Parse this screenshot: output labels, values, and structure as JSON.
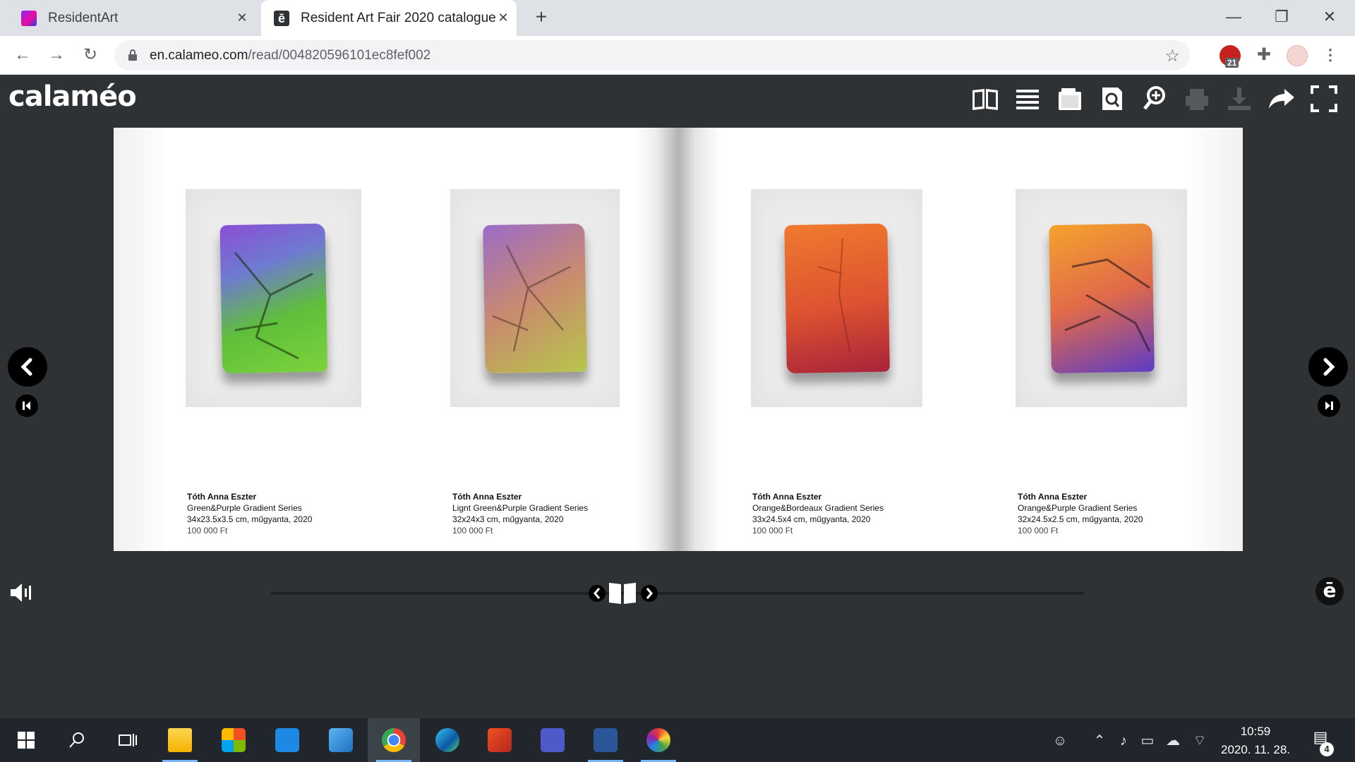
{
  "browser": {
    "tabs": [
      {
        "title": "ResidentArt",
        "close": "✕"
      },
      {
        "title": "Resident Art Fair 2020 catalogue",
        "close": "✕",
        "favicon_text": "ē"
      }
    ],
    "new_tab": "+",
    "window_controls": {
      "minimize": "—",
      "restore": "❐",
      "close": "✕"
    },
    "nav": {
      "back": "←",
      "forward": "→",
      "reload": "↻"
    },
    "url_host": "en.calameo.com",
    "url_path": "/read/004820596101ec8fef002",
    "bookmark_star": "☆",
    "extension_badge": "21",
    "extensions_icon": "✚",
    "menu": "⋮"
  },
  "viewer": {
    "logo": "calaméo",
    "toolbar_icons": [
      "book-view-icon",
      "list-icon",
      "pages-icon",
      "search-icon",
      "zoom-icon",
      "print-icon",
      "download-icon",
      "share-icon",
      "fullscreen-icon"
    ],
    "artworks": [
      {
        "artist": "Tóth Anna Eszter",
        "title": "Green&Purple Gradient Series",
        "details": "34x23.5x3.5 cm, műgyanta, 2020",
        "price": "100 000 Ft",
        "colors": [
          "#8a4fd6",
          "#5fbf3a",
          "#7dd33c"
        ]
      },
      {
        "artist": "Tóth Anna Eszter",
        "title": "Lignt Green&Purple Gradient Series",
        "details": "32x24x3 cm, műgyanta, 2020",
        "price": "100 000 Ft",
        "colors": [
          "#9c6bc9",
          "#c98b6e",
          "#b7c64b"
        ]
      },
      {
        "artist": "Tóth Anna Eszter",
        "title": "Orange&Bordeaux Gradient Series",
        "details": "33x24.5x4 cm, műgyanta, 2020",
        "price": "100 000 Ft",
        "colors": [
          "#f07a2e",
          "#dd5230",
          "#a8233a"
        ]
      },
      {
        "artist": "Tóth Anna Eszter",
        "title": "Orange&Purple Gradient Series",
        "details": "32x24.5x2.5 cm, műgyanta, 2020",
        "price": "100 000 Ft",
        "colors": [
          "#f6a22c",
          "#e06a4a",
          "#5d3bc7"
        ]
      }
    ],
    "calameo_badge": "ē"
  },
  "taskbar": {
    "time": "10:59",
    "date": "2020. 11. 28.",
    "notification_count": "4",
    "apps": [
      "start",
      "search",
      "task-view",
      "file-explorer",
      "store",
      "mail",
      "control-panel",
      "chrome",
      "edge",
      "office",
      "teams",
      "word",
      "paint"
    ]
  }
}
